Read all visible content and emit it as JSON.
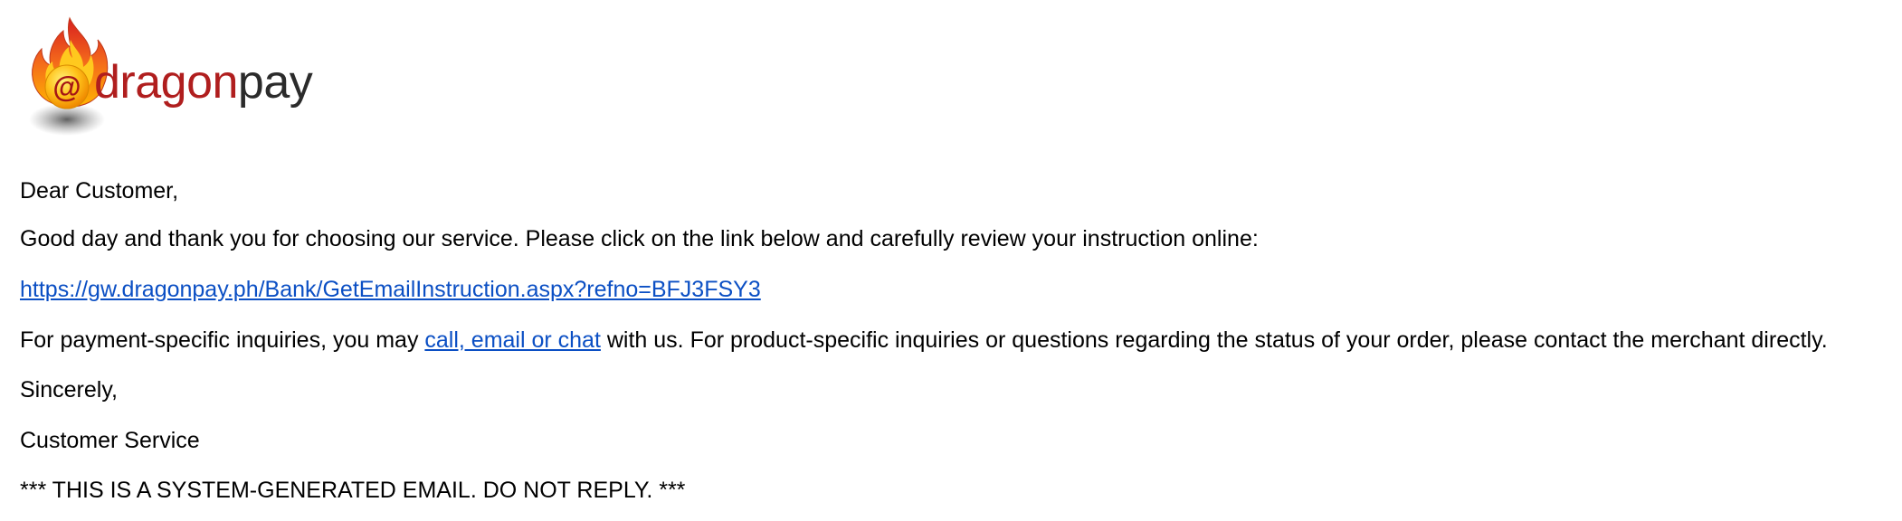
{
  "logo": {
    "at_symbol": "@",
    "brand_part1": "dragon",
    "brand_part2": "pay",
    "brand_color_part1": "#b01e1e",
    "brand_color_part2": "#2b2b2b"
  },
  "email": {
    "greeting": "Dear Customer,",
    "intro": "Good day and thank you for choosing our service. Please click on the link below and carefully review your instruction online:",
    "instruction_link": "https://gw.dragonpay.ph/Bank/GetEmailInstruction.aspx?refno=BFJ3FSY3",
    "inquiry_prefix": "For payment-specific inquiries, you may ",
    "inquiry_link": "call, email or chat",
    "inquiry_suffix": " with us. For product-specific inquiries or questions regarding the status of your order, please contact the merchant directly.",
    "signoff": "Sincerely,",
    "signature": "Customer Service",
    "footer_notice": "*** THIS IS A SYSTEM-GENERATED EMAIL. DO NOT REPLY. ***"
  },
  "colors": {
    "link": "#0b4fc4",
    "flame_orange": "#f7931e",
    "flame_red": "#e8331c",
    "flame_yellow": "#ffd21f"
  }
}
